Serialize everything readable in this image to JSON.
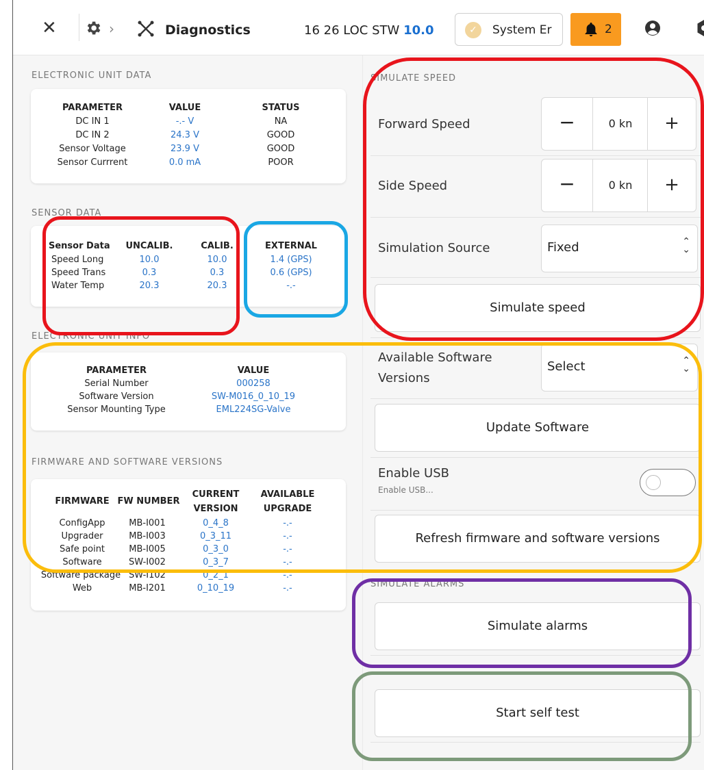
{
  "header": {
    "title": "Diagnostics",
    "loc_prefix": "16 26 LOC STW",
    "stw_value": "10.0",
    "system_label": "System Er",
    "alarm_count": "2",
    "accent": "#1a6fd0",
    "alarm_color": "#f99a1f"
  },
  "electronic_unit_data": {
    "title": "ELECTRONIC UNIT DATA",
    "headers": [
      "PARAMETER",
      "VALUE",
      "STATUS"
    ],
    "rows": [
      {
        "param": "DC IN 1",
        "value": "-.- V",
        "status": "NA"
      },
      {
        "param": "DC IN 2",
        "value": "24.3 V",
        "status": "GOOD"
      },
      {
        "param": "Sensor Voltage",
        "value": "23.9 V",
        "status": "GOOD"
      },
      {
        "param": "Sensor Currrent",
        "value": "0.0 mA",
        "status": "POOR"
      }
    ]
  },
  "sensor_data": {
    "title": "SENSOR DATA",
    "headers": [
      "Sensor Data",
      "UNCALIB.",
      "CALIB.",
      "EXTERNAL"
    ],
    "rows": [
      {
        "name": "Speed Long",
        "uncalib": "10.0",
        "calib": "10.0",
        "external": "1.4 (GPS)"
      },
      {
        "name": "Speed Trans",
        "uncalib": "0.3",
        "calib": "0.3",
        "external": "0.6 (GPS)"
      },
      {
        "name": "Water Temp",
        "uncalib": "20.3",
        "calib": "20.3",
        "external": "-.-"
      }
    ]
  },
  "electronic_unit_info": {
    "title": "ELECTRONIC UNIT INFO",
    "headers": [
      "PARAMETER",
      "VALUE"
    ],
    "rows": [
      {
        "param": "Serial Number",
        "value": "000258"
      },
      {
        "param": "Software Version",
        "value": "SW-M016_0_10_19"
      },
      {
        "param": "Sensor Mounting Type",
        "value": "EML224SG-Valve"
      }
    ]
  },
  "firmware": {
    "title": "FIRMWARE AND SOFTWARE VERSIONS",
    "headers": [
      "FIRMWARE",
      "FW NUMBER",
      "CURRENT",
      "VERSION",
      "AVAILABLE",
      "UPGRADE"
    ],
    "rows": [
      {
        "name": "ConfigApp",
        "fw": "MB-I001",
        "current": "0_4_8",
        "upgrade": "-.-"
      },
      {
        "name": "Upgrader",
        "fw": "MB-I003",
        "current": "0_3_11",
        "upgrade": "-.-"
      },
      {
        "name": "Safe point",
        "fw": "MB-I005",
        "current": "0_3_0",
        "upgrade": "-.-"
      },
      {
        "name": "Software",
        "fw": "SW-I002",
        "current": "0_3_7",
        "upgrade": "-.-"
      },
      {
        "name": "Software package",
        "fw": "SW-I102",
        "current": "0_2_1",
        "upgrade": "-.-"
      },
      {
        "name": "Web",
        "fw": "MB-I201",
        "current": "0_10_19",
        "upgrade": "-.-"
      }
    ]
  },
  "simulate_speed": {
    "title": "SIMULATE SPEED",
    "forward_label": "Forward Speed",
    "forward_value": "0 kn",
    "side_label": "Side Speed",
    "side_value": "0 kn",
    "minus": "−",
    "plus": "+",
    "source_label": "Simulation Source",
    "source_value": "Fixed",
    "simulate_button": "Simulate speed"
  },
  "software": {
    "available_label_1": "Available Software",
    "available_label_2": "Versions",
    "select_value": "Select",
    "update_button": "Update Software",
    "usb_label": "Enable USB",
    "usb_sub": "Enable USB...",
    "usb_enabled": false,
    "refresh_button": "Refresh firmware and software versions"
  },
  "simulate_alarms": {
    "title": "SIMULATE ALARMS",
    "button": "Simulate alarms"
  },
  "self_test": {
    "button": "Start self test"
  },
  "highlights": {
    "red": "#e8141c",
    "blue": "#1aa7e4",
    "yellow": "#fbbd0c",
    "purple": "#6f2fa5",
    "green": "#7d9a7a"
  }
}
